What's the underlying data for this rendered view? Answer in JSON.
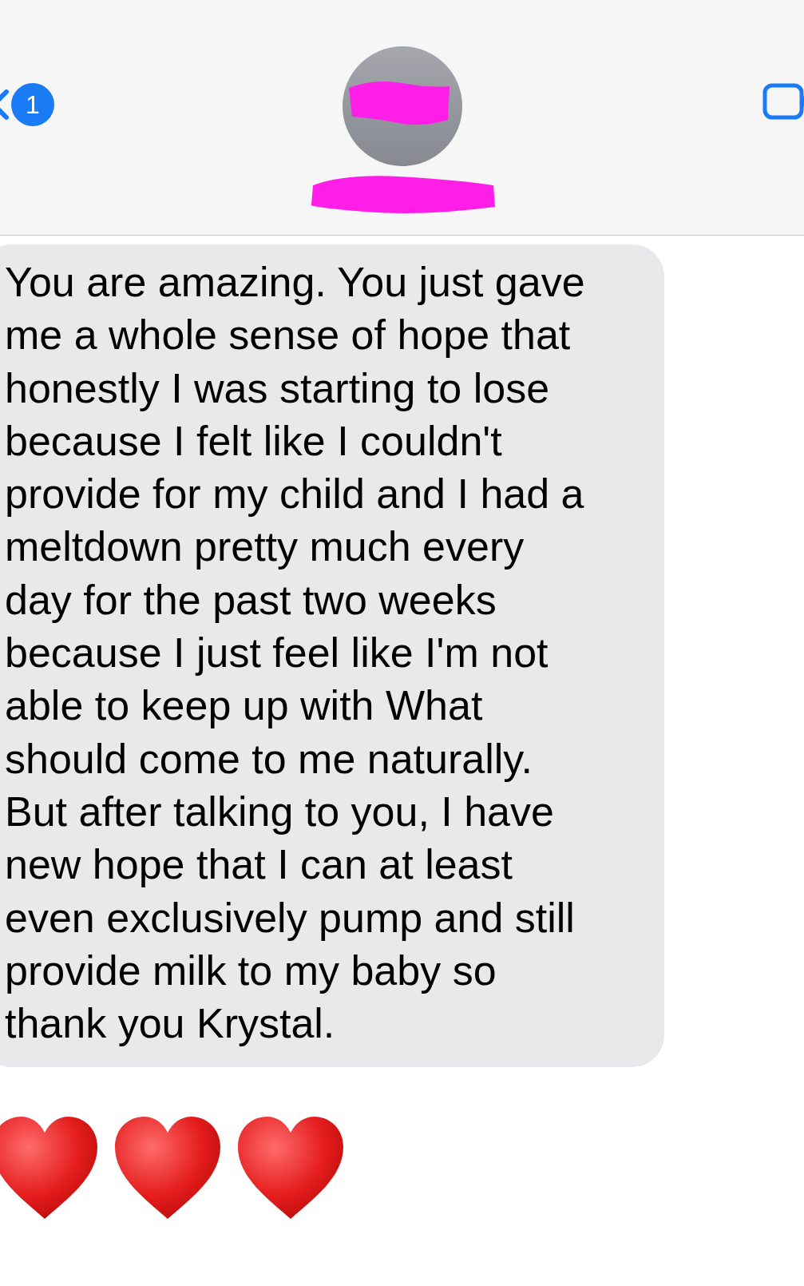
{
  "header": {
    "back_badge": "1",
    "avatar": {
      "redacted": true
    },
    "name": {
      "redacted": true
    }
  },
  "messages": [
    {
      "kind": "text",
      "text": "You are amazing. You just gave\nme a whole sense of hope that\nhonestly I was starting to lose\nbecause I felt like I couldn't\nprovide for my child and I had a\nmeltdown pretty much every\nday for the past two weeks\nbecause I just feel like I'm not\nable to keep up with What\nshould come to me naturally.\nBut after talking to you, I have\nnew hope that I can at least\neven exclusively pump and still\nprovide milk to my baby so\nthank you Krystal."
    },
    {
      "kind": "emoji",
      "items": [
        {
          "kind": "heart"
        },
        {
          "kind": "heart"
        },
        {
          "kind": "heart"
        }
      ]
    }
  ]
}
